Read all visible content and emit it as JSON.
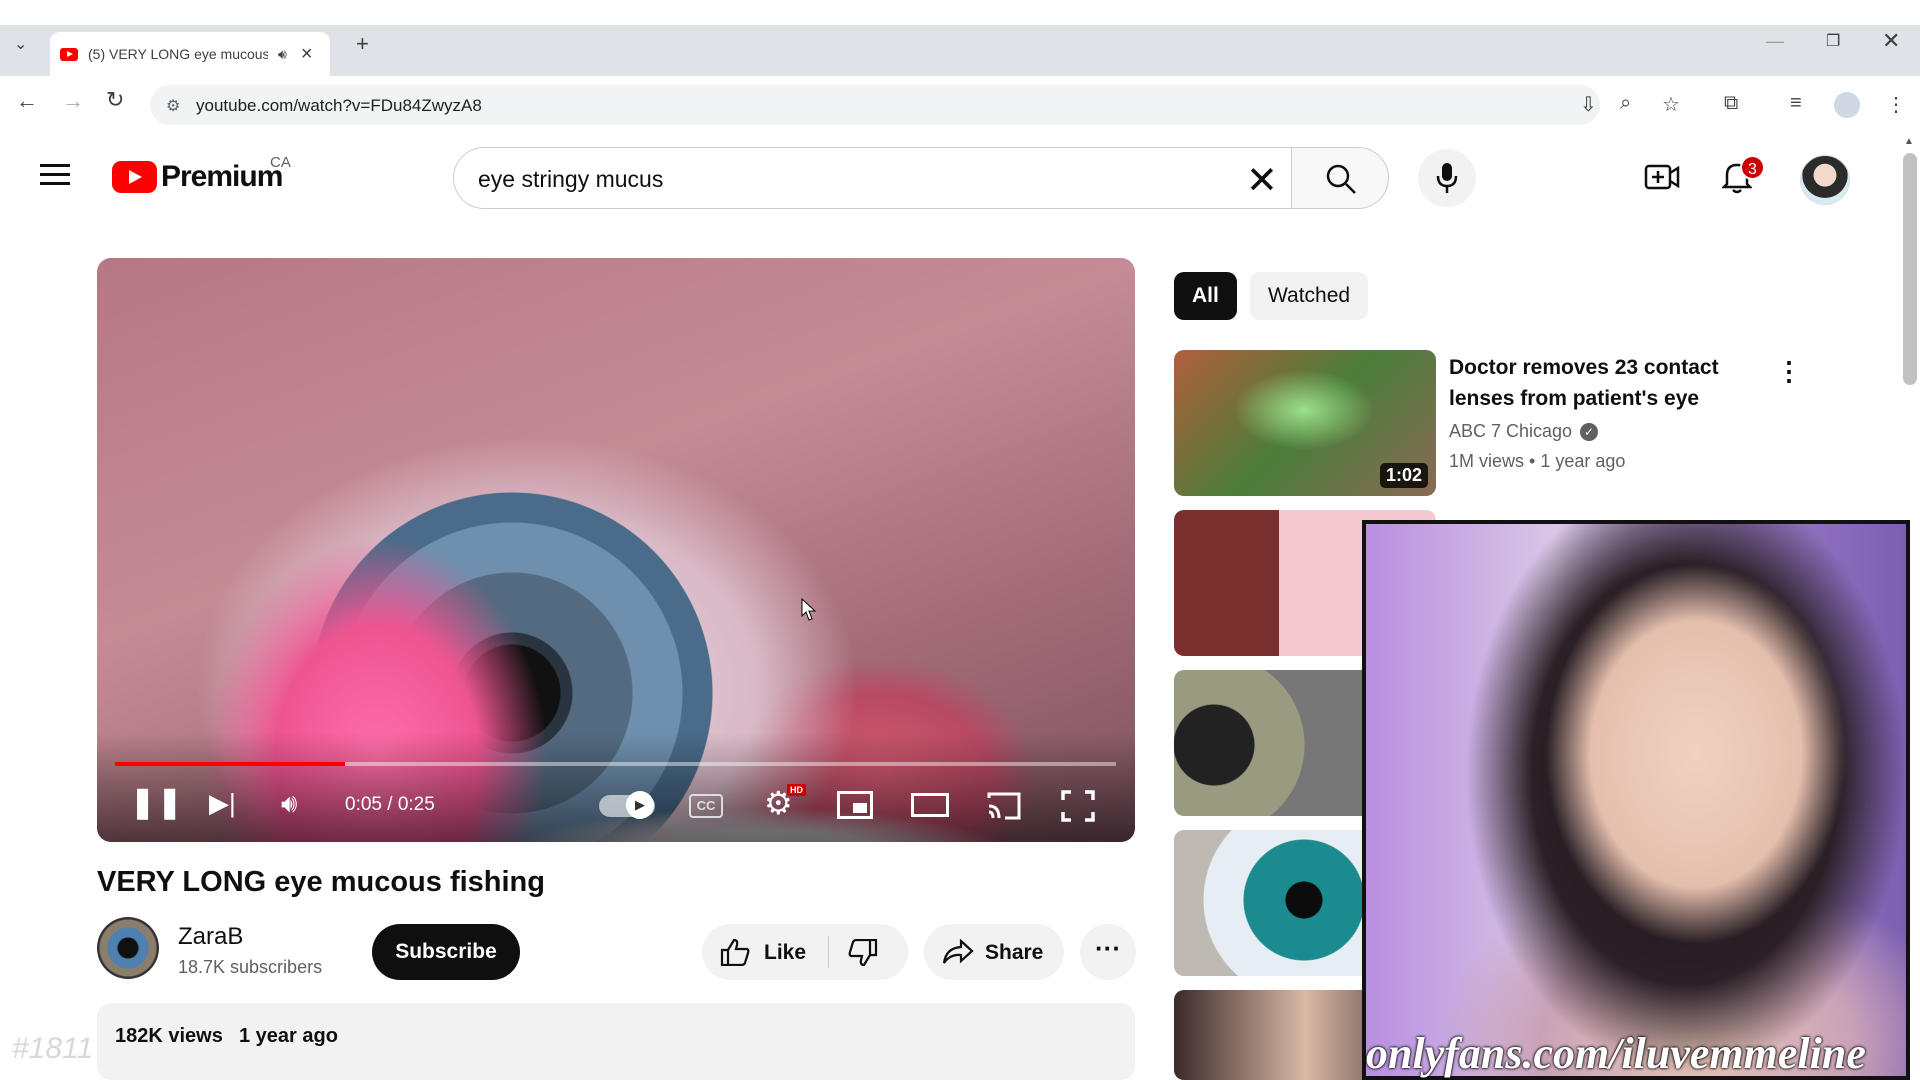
{
  "browser": {
    "tab_title": "(5) VERY LONG eye mucous fishing",
    "url": "youtube.com/watch?v=FDu84ZwyzA8"
  },
  "header": {
    "logo_word": "Premium",
    "region": "CA",
    "search_value": "eye stringy mucus",
    "notification_count": "3"
  },
  "player": {
    "timecode": "0:05 / 0:25",
    "progress_fraction": 0.23,
    "cc_label": "CC",
    "hd_label": "HD"
  },
  "video": {
    "title": "VERY LONG eye mucous fishing",
    "channel": "ZaraB",
    "subscribers": "18.7K subscribers",
    "subscribe_label": "Subscribe",
    "like_label": "Like",
    "share_label": "Share",
    "views": "182K views",
    "published": "1 year ago"
  },
  "sidebar": {
    "chips": [
      "All",
      "Watched"
    ],
    "recommendations": [
      {
        "title": "Doctor removes 23 contact lenses from patient's eye",
        "channel": "ABC 7 Chicago",
        "meta": "1M views • 1 year ago",
        "duration": "1:02"
      }
    ]
  },
  "overlay": {
    "webcam_text": "onlyfans.com/iluvemmeline",
    "stream_tag": "#1811"
  },
  "colors": {
    "youtube_red": "#ff0000",
    "chip_active": "#0f0f0f",
    "secondary_text": "#606060"
  },
  "icons": [
    "hamburger-menu-icon",
    "search-icon",
    "clear-icon",
    "mic-icon",
    "create-video-icon",
    "bell-icon",
    "pause-icon",
    "next-icon",
    "volume-icon",
    "settings-icon",
    "miniplayer-icon",
    "theater-icon",
    "cast-icon",
    "fullscreen-icon",
    "like-icon",
    "dislike-icon",
    "share-icon",
    "more-icon"
  ]
}
